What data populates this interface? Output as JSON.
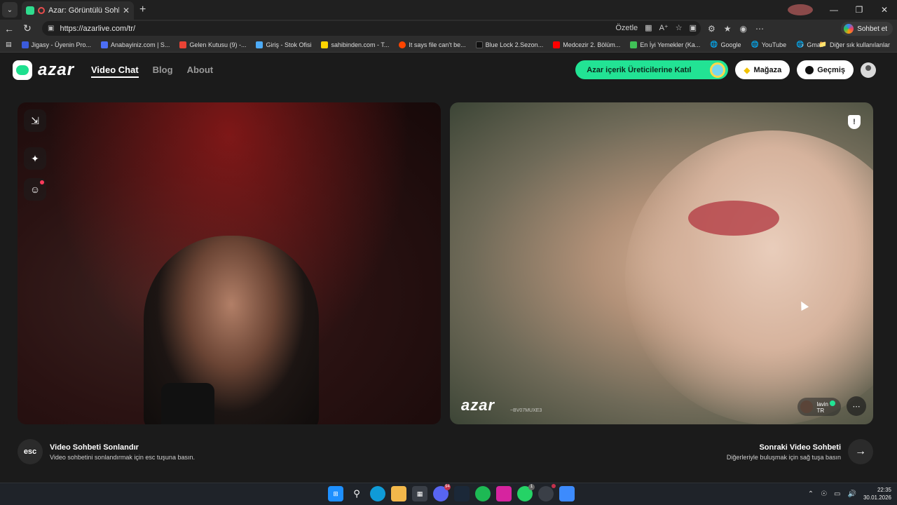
{
  "browser": {
    "tab_title": "Azar: Görüntülü Sohbet & Ye",
    "url": "https://azarlive.com/tr/",
    "summarize_label": "Özetle",
    "copilot_label": "Sohbet et",
    "other_bookmarks": "Diğer sık kullanılanlar",
    "bookmarks": [
      {
        "label": "Jigasy - Üyenin Pro...",
        "color": "#3b5bdb"
      },
      {
        "label": "Anabayiniz.com | S...",
        "color": "#4c6ef5"
      },
      {
        "label": "Gelen Kutusu (9) -...",
        "color": "#ea4335"
      },
      {
        "label": "Giriş - Stok Ofisi",
        "color": "#4dabf7"
      },
      {
        "label": "sahibinden.com - T...",
        "color": "#ffd400"
      },
      {
        "label": "It says file can't be...",
        "color": "#ff4500"
      },
      {
        "label": "Blue Lock 2.Sezon...",
        "color": "#222222"
      },
      {
        "label": "Medcezir 2. Bölüm...",
        "color": "#ff0000"
      },
      {
        "label": "En İyi Yemekler (Ka...",
        "color": "#40c057"
      },
      {
        "label": "Google",
        "color": "#888888"
      },
      {
        "label": "YouTube",
        "color": "#888888"
      },
      {
        "label": "Gmail",
        "color": "#888888"
      }
    ]
  },
  "header": {
    "logo_text": "azar",
    "nav": [
      {
        "label": "Video Chat",
        "active": true
      },
      {
        "label": "Blog",
        "active": false
      },
      {
        "label": "About",
        "active": false
      }
    ],
    "creators_cta": "Azar içerik Üreticilerine Katıl",
    "shop_label": "Mağaza",
    "history_label": "Geçmiş"
  },
  "remote": {
    "watermark": "azar",
    "watermark_id": "~BV07MUXE3",
    "peer_name": "lavin",
    "peer_country": "TR"
  },
  "footer": {
    "esc_key": "esc",
    "end_title": "Video Sohbeti Sonlandır",
    "end_sub": "Video sohbetini sonlandırmak için esc tuşuna basın.",
    "next_title": "Sonraki Video Sohbeti",
    "next_sub": "Diğerleriyle buluşmak için sağ tuşa basın"
  },
  "taskbar": {
    "time": "22:35",
    "date": "30.01.2026",
    "badges": {
      "discord": "94",
      "whatsapp": "1"
    }
  },
  "colors": {
    "accent": "#22e394",
    "background": "#1b1b1b"
  }
}
